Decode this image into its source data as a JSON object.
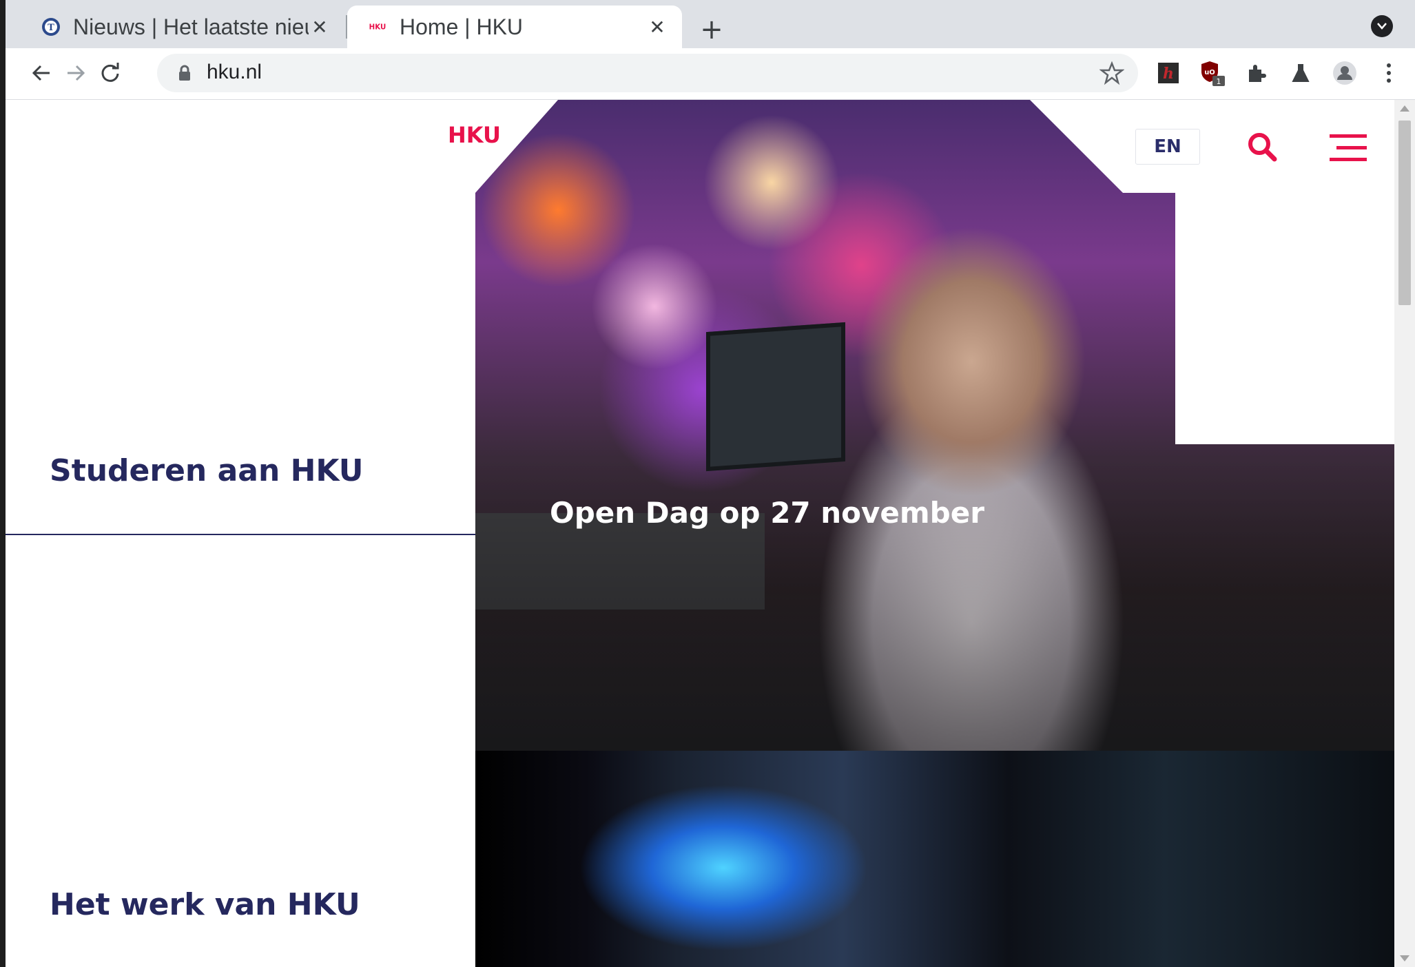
{
  "browser": {
    "tabs": [
      {
        "title": "Nieuws | Het laatste nieuws",
        "favicon": "telegraaf-icon",
        "active": false
      },
      {
        "title": "Home | HKU",
        "favicon": "hku-icon",
        "active": true
      }
    ],
    "new_tab_label": "+",
    "address": "hku.nl",
    "colors": {
      "tab_strip": "#dee1e6",
      "omnibox": "#f1f3f4"
    }
  },
  "site": {
    "logo_text": "HKU",
    "lang_button": "EN",
    "brand_color": "#e8124b",
    "heading_color": "#25285e"
  },
  "hero": {
    "caption": "Open Dag op 27 november"
  },
  "left": {
    "heading_1": "Studeren aan HKU",
    "heading_2": "Het werk van HKU"
  }
}
